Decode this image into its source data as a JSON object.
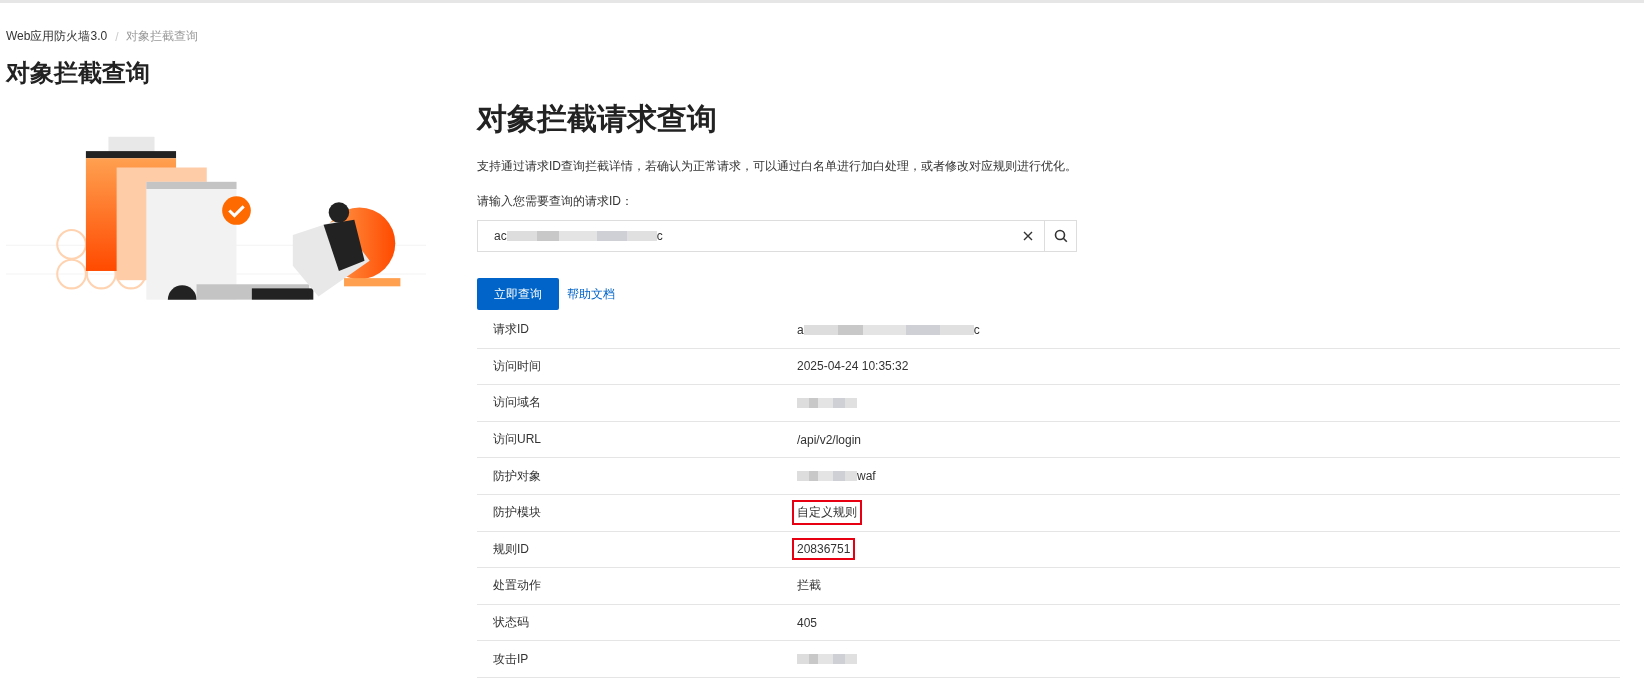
{
  "breadcrumb": [
    {
      "label": "Web应用防火墙3.0",
      "current": false
    },
    {
      "label": "对象拦截查询",
      "current": true
    }
  ],
  "breadcrumb_separator": "/",
  "page_title": "对象拦截查询",
  "heading": "对象拦截请求查询",
  "description": "支持通过请求ID查询拦截详情，若确认为正常请求，可以通过白名单进行加白处理，或者修改对应规则进行优化。",
  "search": {
    "label": "请输入您需要查询的请求ID：",
    "value_parts": [
      {
        "kind": "text",
        "text": "ac"
      },
      {
        "kind": "redacted"
      },
      {
        "kind": "text",
        "text": "c"
      }
    ]
  },
  "query_button": "立即查询",
  "help_link": "帮助文档",
  "details": [
    {
      "label": "请求ID",
      "highlighted": false,
      "value": [
        {
          "kind": "text",
          "text": "a"
        },
        {
          "kind": "redacted"
        },
        {
          "kind": "text",
          "text": "c"
        }
      ]
    },
    {
      "label": "访问时间",
      "highlighted": false,
      "value": [
        {
          "kind": "text",
          "text": "2025-04-24 10:35:32"
        }
      ]
    },
    {
      "label": "访问域名",
      "highlighted": false,
      "value": [
        {
          "kind": "redacted"
        }
      ]
    },
    {
      "label": "访问URL",
      "highlighted": false,
      "value": [
        {
          "kind": "text",
          "text": "/api/v2/login"
        }
      ]
    },
    {
      "label": "防护对象",
      "highlighted": false,
      "value": [
        {
          "kind": "redacted"
        },
        {
          "kind": "text",
          "text": "waf"
        }
      ]
    },
    {
      "label": "防护模块",
      "highlighted": true,
      "value": [
        {
          "kind": "text",
          "text": "自定义规则"
        }
      ]
    },
    {
      "label": "规则ID",
      "highlighted": true,
      "value": [
        {
          "kind": "text",
          "text": "20836751"
        }
      ]
    },
    {
      "label": "处置动作",
      "highlighted": false,
      "value": [
        {
          "kind": "text",
          "text": "拦截"
        }
      ]
    },
    {
      "label": "状态码",
      "highlighted": false,
      "value": [
        {
          "kind": "text",
          "text": "405"
        }
      ]
    },
    {
      "label": "攻击IP",
      "highlighted": false,
      "value": [
        {
          "kind": "redacted"
        }
      ]
    }
  ]
}
